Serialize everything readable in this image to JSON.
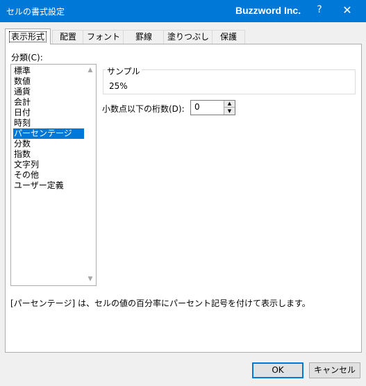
{
  "window": {
    "title": "セルの書式設定",
    "brand": "Buzzword Inc.",
    "help_label": "?",
    "close_label": "✕"
  },
  "tabs": [
    {
      "label": "表示形式",
      "active": true
    },
    {
      "label": "配置"
    },
    {
      "label": "フォント"
    },
    {
      "label": "罫線"
    },
    {
      "label": "塗りつぶし"
    },
    {
      "label": "保護"
    }
  ],
  "category": {
    "label": "分類(C):",
    "items": [
      "標準",
      "数値",
      "通貨",
      "会計",
      "日付",
      "時刻",
      "パーセンテージ",
      "分数",
      "指数",
      "文字列",
      "その他",
      "ユーザー定義"
    ],
    "selected": "パーセンテージ"
  },
  "sample": {
    "legend": "サンプル",
    "value": "25%"
  },
  "decimal": {
    "label": "小数点以下の桁数(D):",
    "value": "0"
  },
  "description": "[パーセンテージ] は、セルの値の百分率にパーセント記号を付けて表示します。",
  "buttons": {
    "ok": "OK",
    "cancel": "キャンセル"
  },
  "colors": {
    "titlebar": "#0078d7",
    "selection": "#0078d7"
  }
}
